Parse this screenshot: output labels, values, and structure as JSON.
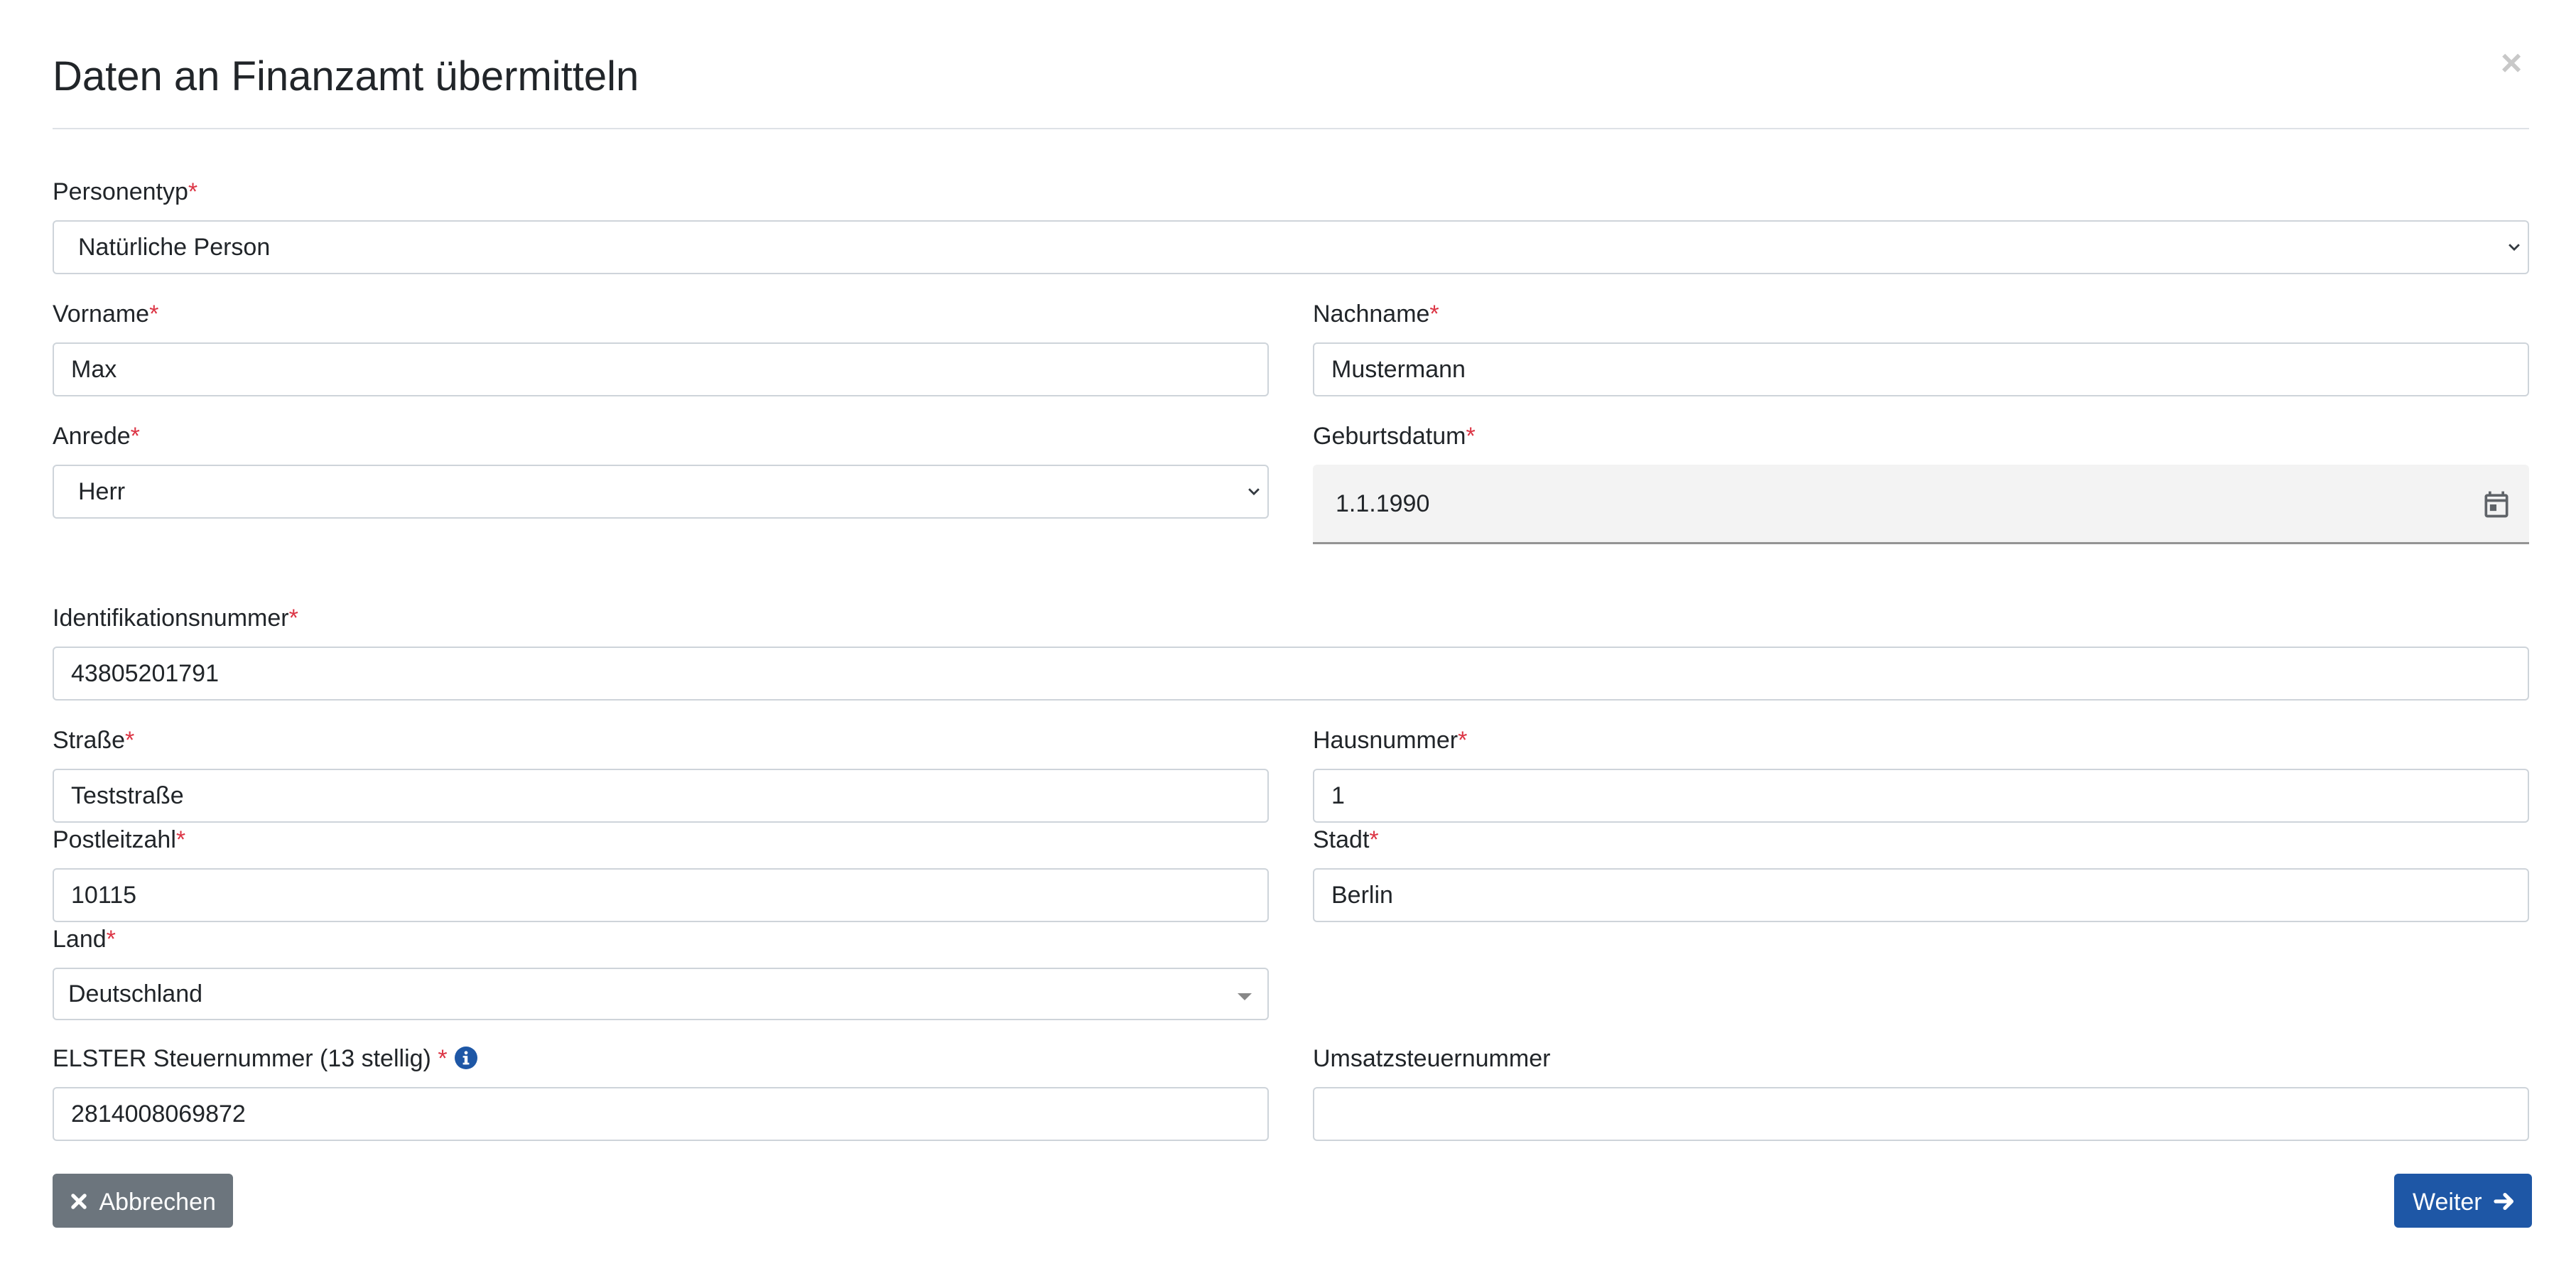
{
  "modal": {
    "title": "Daten an Finanzamt übermitteln",
    "close_glyph": "×",
    "required_marker": "*"
  },
  "form": {
    "personentyp": {
      "label": "Personentyp",
      "value": "Natürliche Person"
    },
    "vorname": {
      "label": "Vorname",
      "value": "Max"
    },
    "nachname": {
      "label": "Nachname",
      "value": "Mustermann"
    },
    "anrede": {
      "label": "Anrede",
      "value": "Herr"
    },
    "geburtsdatum": {
      "label": "Geburtsdatum",
      "value": "1.1.1990"
    },
    "identifikationsnummer": {
      "label": "Identifikationsnummer",
      "value": "43805201791"
    },
    "strasse": {
      "label": "Straße",
      "value": "Teststraße"
    },
    "hausnummer": {
      "label": "Hausnummer",
      "value": "1"
    },
    "postleitzahl": {
      "label": "Postleitzahl",
      "value": "10115"
    },
    "stadt": {
      "label": "Stadt",
      "value": "Berlin"
    },
    "land": {
      "label": "Land",
      "value": "Deutschland"
    },
    "elster": {
      "label": "ELSTER Steuernummer (13 stellig)",
      "required_marker": " *",
      "value": "2814008069872"
    },
    "umsatzsteuer": {
      "label": "Umsatzsteuernummer",
      "value": ""
    }
  },
  "buttons": {
    "cancel_label": "Abbrechen",
    "next_label": "Weiter"
  },
  "colors": {
    "primary": "#1e57a6",
    "secondary": "#6c757d",
    "required": "#dc3545",
    "info": "#1e57a6"
  },
  "icons": [
    "close-icon",
    "chevron-down-icon",
    "calendar-icon",
    "info-icon",
    "x-icon",
    "arrow-right-icon"
  ]
}
